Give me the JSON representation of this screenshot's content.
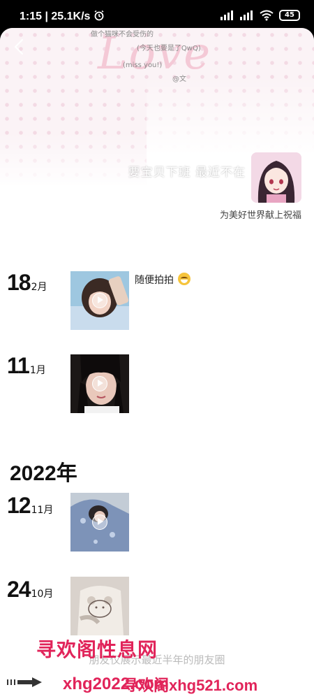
{
  "status": {
    "time": "1:15",
    "speed": "25.1K/s",
    "battery": "45"
  },
  "profile": {
    "nickname": "要宝贝下班 最近不在",
    "signature": "为美好世界献上祝福"
  },
  "cover_deco": {
    "line1": "做个猫咪不会受伤的",
    "line2": "(今天也要是了QwQ)",
    "line3": "(miss you!)",
    "mark": "@文"
  },
  "entries": [
    {
      "day": "18",
      "month": "2月",
      "caption": "随便拍拍"
    },
    {
      "day": "11",
      "month": "1月",
      "caption": ""
    },
    {
      "day": "12",
      "month": "11月",
      "caption": ""
    },
    {
      "day": "24",
      "month": "10月",
      "caption": ""
    }
  ],
  "year_header": "2022年",
  "bottom_hint": "朋友仅展示最近半年的朋友圈",
  "watermark": {
    "big": "寻欢阁性息网",
    "left": "xhg2022.com",
    "right": "寻欢阁xhg521.com"
  },
  "colors": {
    "watermark": "#e1245a"
  },
  "icons": [
    "back-icon",
    "play-icon",
    "grin-emoji-icon",
    "wifi-icon",
    "alarm-icon",
    "signal-icon",
    "battery-icon"
  ]
}
